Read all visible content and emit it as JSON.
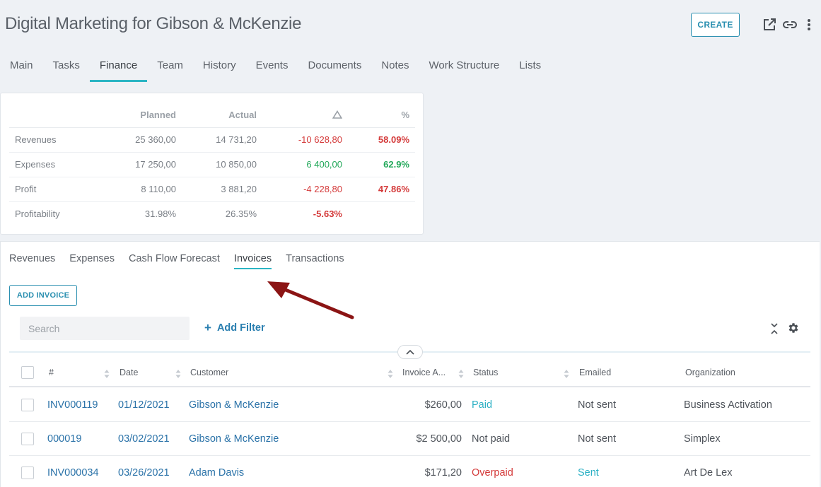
{
  "header": {
    "title": "Digital Marketing for Gibson & McKenzie",
    "create_label": "CREATE"
  },
  "main_tabs": [
    "Main",
    "Tasks",
    "Finance",
    "Team",
    "History",
    "Events",
    "Documents",
    "Notes",
    "Work Structure",
    "Lists"
  ],
  "main_tabs_active": "Finance",
  "summary": {
    "headers": {
      "planned": "Planned",
      "actual": "Actual",
      "delta": "△",
      "percent": "%"
    },
    "rows": [
      {
        "label": "Revenues",
        "planned": "25 360,00",
        "actual": "14 731,20",
        "delta": "-10 628,80",
        "percent": "58.09%"
      },
      {
        "label": "Expenses",
        "planned": "17 250,00",
        "actual": "10 850,00",
        "delta": "6 400,00",
        "percent": "62.9%"
      },
      {
        "label": "Profit",
        "planned": "8 110,00",
        "actual": "3 881,20",
        "delta": "-4 228,80",
        "percent": "47.86%"
      },
      {
        "label": "Profitability",
        "planned": "31.98%",
        "actual": "26.35%",
        "delta": "-5.63%",
        "percent": ""
      }
    ]
  },
  "sub_tabs": [
    "Revenues",
    "Expenses",
    "Cash Flow Forecast",
    "Invoices",
    "Transactions"
  ],
  "sub_tabs_active": "Invoices",
  "invoices": {
    "add_label": "ADD INVOICE",
    "search_placeholder": "Search",
    "add_filter_label": "Add Filter",
    "add_filter_plus": "+",
    "columns": {
      "number": "#",
      "date": "Date",
      "customer": "Customer",
      "amount": "Invoice A...",
      "status": "Status",
      "emailed": "Emailed",
      "organization": "Organization"
    },
    "rows": [
      {
        "number": "INV000119",
        "date": "01/12/2021",
        "customer": "Gibson & McKenzie",
        "amount": "$260,00",
        "status": "Paid",
        "emailed": "Not sent",
        "organization": "Business Activation"
      },
      {
        "number": "000019",
        "date": "03/02/2021",
        "customer": "Gibson & McKenzie",
        "amount": "$2 500,00",
        "status": "Not paid",
        "emailed": "Not sent",
        "organization": "Simplex"
      },
      {
        "number": "INV000034",
        "date": "03/26/2021",
        "customer": "Adam Davis",
        "amount": "$171,20",
        "status": "Overpaid",
        "emailed": "Sent",
        "organization": "Art De Lex"
      }
    ]
  },
  "colors": {
    "accent": "#2bb5c4",
    "primary_button": "#2a8fb0",
    "link": "#2a72a8",
    "negative": "#d43a3a",
    "positive": "#23a85a",
    "annotation_arrow": "#8b1414"
  },
  "icons": {
    "open_external": "external-link-icon",
    "copy_link": "link-icon",
    "more": "kebab-menu-icon",
    "collapse_all": "collapse-vertical-icon",
    "settings": "gear-icon",
    "toggle_collapse": "chevron-up-icon",
    "sort": "sort-icon"
  }
}
